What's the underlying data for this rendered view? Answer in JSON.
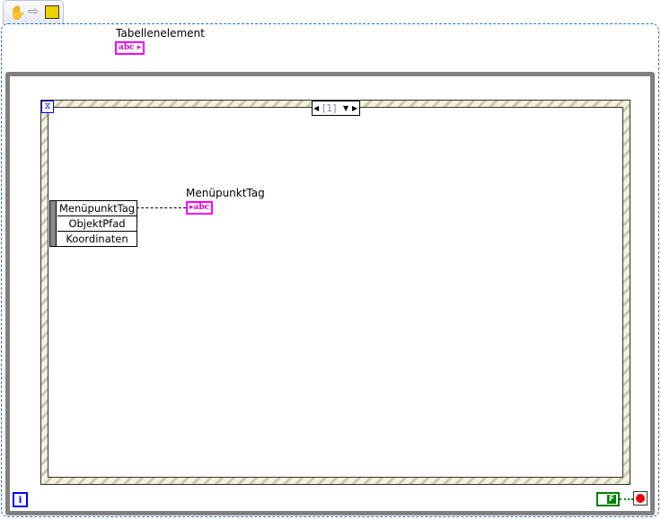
{
  "toolbar": {
    "icons": [
      "hand-tool-icon",
      "arrow-icon",
      "run-icon"
    ]
  },
  "diagram": {
    "table_element_label": "Tabellenelement",
    "abc_text": "abc",
    "event_case_selector": "[1]",
    "unbundle_items": [
      "MenüpunktTag",
      "ObjektPfad",
      "Koordinaten"
    ],
    "indicator_label": "MenüpunktTag",
    "iteration_terminal": "i",
    "false_constant": "F"
  },
  "colors": {
    "string": "#ff00ff",
    "boolean": "#008000",
    "loop": "#808080",
    "event": "#0000ff"
  }
}
